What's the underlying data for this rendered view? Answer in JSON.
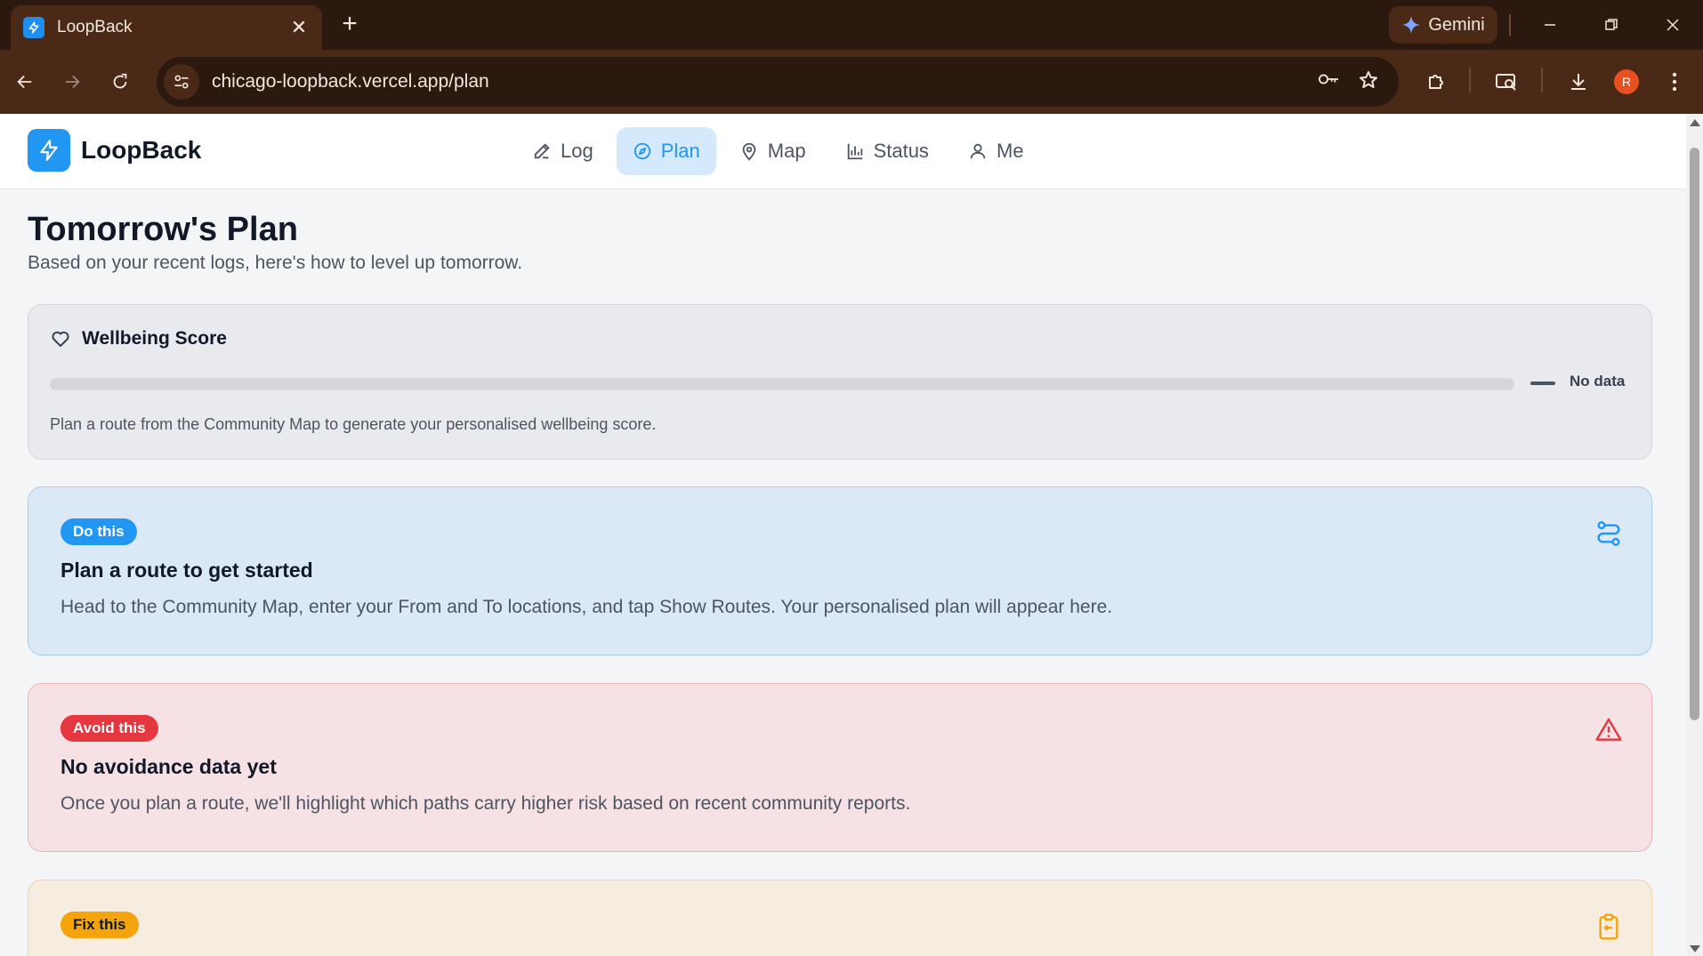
{
  "browser": {
    "tab_title": "LoopBack",
    "url": "chicago-loopback.vercel.app/plan",
    "gemini_label": "Gemini",
    "profile_initial": "R"
  },
  "app": {
    "name": "LoopBack",
    "nav": [
      {
        "label": "Log",
        "icon": "pencil-icon",
        "active": false
      },
      {
        "label": "Plan",
        "icon": "compass-icon",
        "active": true
      },
      {
        "label": "Map",
        "icon": "map-pin-icon",
        "active": false
      },
      {
        "label": "Status",
        "icon": "bar-chart-icon",
        "active": false
      },
      {
        "label": "Me",
        "icon": "user-icon",
        "active": false
      }
    ]
  },
  "page": {
    "title": "Tomorrow's Plan",
    "subtitle": "Based on your recent logs, here's how to level up tomorrow."
  },
  "wellbeing": {
    "heading": "Wellbeing Score",
    "status": "No data",
    "progress": 0,
    "note": "Plan a route from the Community Map to generate your personalised wellbeing score."
  },
  "cards": {
    "do": {
      "badge": "Do this",
      "title": "Plan a route to get started",
      "description": "Head to the Community Map, enter your From and To locations, and tap Show Routes. Your personalised plan will appear here.",
      "icon": "route-icon"
    },
    "avoid": {
      "badge": "Avoid this",
      "title": "No avoidance data yet",
      "description": "Once you plan a route, we'll highlight which paths carry higher risk based on recent community reports.",
      "icon": "warning-triangle-icon"
    },
    "fix": {
      "badge": "Fix this",
      "icon": "clipboard-icon"
    }
  },
  "colors": {
    "accent": "#2196f3",
    "danger": "#e5373f",
    "warning": "#f5a30a"
  }
}
